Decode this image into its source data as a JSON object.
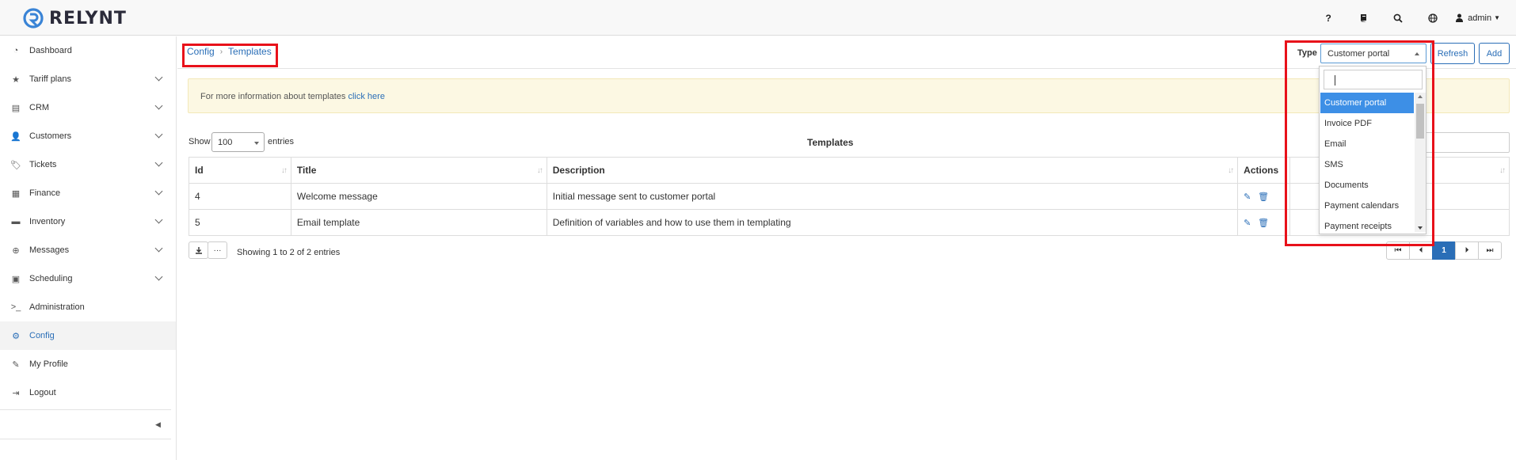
{
  "brand": {
    "name": "RELYNT",
    "accent": "#2a6eb7",
    "highlight": "#e8111a"
  },
  "topbar": {
    "icons": [
      "help-icon",
      "book-icon",
      "search-icon",
      "globe-icon"
    ],
    "help_glyph": "?",
    "user": "admin"
  },
  "sidebar": {
    "items": [
      {
        "label": "Dashboard",
        "icon": "dashboard-icon",
        "glyph": "◔",
        "expandable": false
      },
      {
        "label": "Tariff plans",
        "icon": "star-icon",
        "glyph": "★",
        "expandable": true
      },
      {
        "label": "CRM",
        "icon": "crm-icon",
        "glyph": "▤",
        "expandable": true
      },
      {
        "label": "Customers",
        "icon": "user-icon",
        "glyph": "👤",
        "expandable": true
      },
      {
        "label": "Tickets",
        "icon": "ticket-icon",
        "glyph": "🏷",
        "expandable": true
      },
      {
        "label": "Finance",
        "icon": "calculator-icon",
        "glyph": "▦",
        "expandable": true
      },
      {
        "label": "Inventory",
        "icon": "folder-icon",
        "glyph": "▬",
        "expandable": true
      },
      {
        "label": "Messages",
        "icon": "lifebuoy-icon",
        "glyph": "⊕",
        "expandable": true
      },
      {
        "label": "Scheduling",
        "icon": "calendar-icon",
        "glyph": "▣",
        "expandable": true
      },
      {
        "label": "Administration",
        "icon": "terminal-icon",
        "glyph": ">_",
        "expandable": false
      },
      {
        "label": "Config",
        "icon": "cogs-icon",
        "glyph": "⚙",
        "expandable": false,
        "active": true
      },
      {
        "label": "My Profile",
        "icon": "pencil-icon",
        "glyph": "✎",
        "expandable": false
      },
      {
        "label": "Logout",
        "icon": "logout-icon",
        "glyph": "⇥",
        "expandable": false
      }
    ]
  },
  "breadcrumb": {
    "items": [
      "Config",
      "Templates"
    ]
  },
  "toolbar": {
    "type_label": "Type",
    "type_value": "Customer portal",
    "refresh_label": "Refresh",
    "add_label": "Add"
  },
  "info": {
    "text": "For more information about templates ",
    "link": "click here"
  },
  "table": {
    "show_label": "Show",
    "page_size": "100",
    "entries_label": "entries",
    "title": "Templates",
    "columns": [
      "Id",
      "Title",
      "Description",
      "Actions",
      ""
    ],
    "rows": [
      {
        "id": "4",
        "title": "Welcome message",
        "description": "Initial message sent to customer portal"
      },
      {
        "id": "5",
        "title": "Email template",
        "description": "Definition of variables and how to use them in templating"
      }
    ],
    "showing_text": "Showing 1 to 2 of 2 entries",
    "current_page": "1"
  },
  "type_dropdown": {
    "options": [
      "Customer portal",
      "Invoice PDF",
      "Email",
      "SMS",
      "Documents",
      "Payment calendars",
      "Payment receipts"
    ],
    "selected_index": 0
  }
}
